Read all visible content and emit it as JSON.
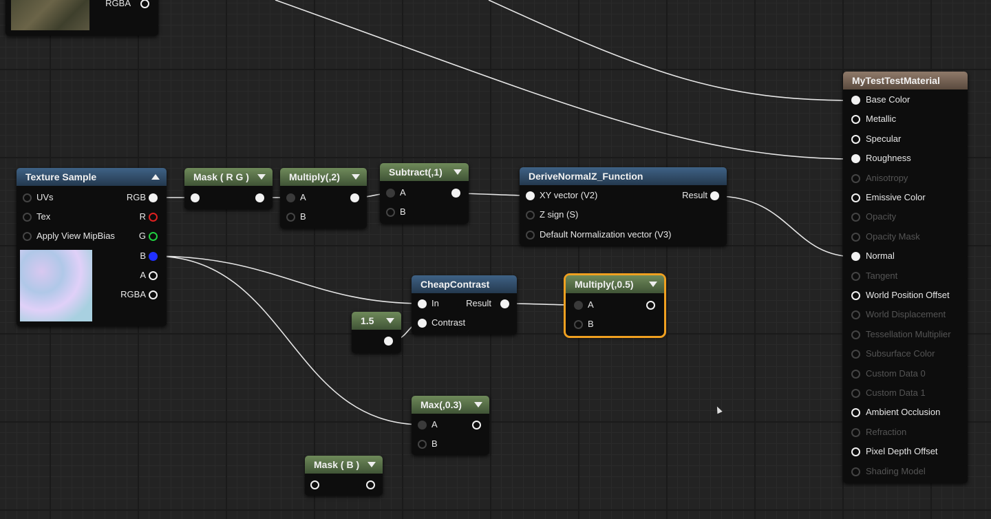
{
  "top_left_node": {
    "pin_rgba": "RGBA"
  },
  "texture_sample": {
    "title": "Texture Sample",
    "inputs": [
      "UVs",
      "Tex",
      "Apply View MipBias"
    ],
    "outputs": [
      "RGB",
      "R",
      "G",
      "B",
      "A",
      "RGBA"
    ]
  },
  "mask_rg": {
    "title": "Mask ( R G )"
  },
  "multiply_2": {
    "title": "Multiply(,2)",
    "inputs": [
      "A",
      "B"
    ]
  },
  "subtract_1": {
    "title": "Subtract(,1)",
    "inputs": [
      "A",
      "B"
    ]
  },
  "derive_normal": {
    "title": "DeriveNormalZ_Function",
    "inputs": [
      "XY vector (V2)",
      "Z sign (S)",
      "Default Normalization vector (V3)"
    ],
    "output": "Result"
  },
  "cheap_contrast": {
    "title": "CheapContrast",
    "inputs": [
      "In",
      "Contrast"
    ],
    "output": "Result"
  },
  "constant": {
    "value": "1.5"
  },
  "multiply_05": {
    "title": "Multiply(,0.5)",
    "inputs": [
      "A",
      "B"
    ]
  },
  "max_03": {
    "title": "Max(,0.3)",
    "inputs": [
      "A",
      "B"
    ]
  },
  "mask_b": {
    "title": "Mask ( B )"
  },
  "material": {
    "title": "MyTestTestMaterial",
    "pins": [
      {
        "label": "Base Color",
        "state": "filled"
      },
      {
        "label": "Metallic",
        "state": "hollow"
      },
      {
        "label": "Specular",
        "state": "hollow"
      },
      {
        "label": "Roughness",
        "state": "filled"
      },
      {
        "label": "Anisotropy",
        "state": "dim"
      },
      {
        "label": "Emissive Color",
        "state": "hollow"
      },
      {
        "label": "Opacity",
        "state": "dim"
      },
      {
        "label": "Opacity Mask",
        "state": "dim"
      },
      {
        "label": "Normal",
        "state": "filled"
      },
      {
        "label": "Tangent",
        "state": "dim"
      },
      {
        "label": "World Position Offset",
        "state": "hollow"
      },
      {
        "label": "World Displacement",
        "state": "dim"
      },
      {
        "label": "Tessellation Multiplier",
        "state": "dim"
      },
      {
        "label": "Subsurface Color",
        "state": "dim"
      },
      {
        "label": "Custom Data 0",
        "state": "dim"
      },
      {
        "label": "Custom Data 1",
        "state": "dim"
      },
      {
        "label": "Ambient Occlusion",
        "state": "hollow"
      },
      {
        "label": "Refraction",
        "state": "dim"
      },
      {
        "label": "Pixel Depth Offset",
        "state": "hollow"
      },
      {
        "label": "Shading Model",
        "state": "dim"
      }
    ]
  },
  "colors": {
    "header_blue": "#3f6285",
    "header_green": "#6f8a5a",
    "header_brown": "#8f7a6a",
    "selection": "#f0a020",
    "pin_r": "#e02020",
    "pin_g": "#20d040",
    "pin_b": "#2030ff"
  }
}
